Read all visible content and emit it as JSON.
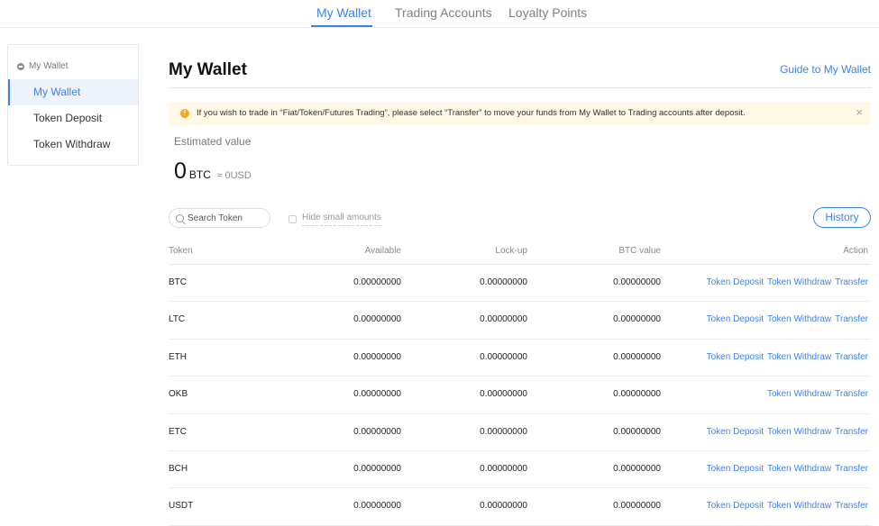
{
  "topnav": {
    "tabs": [
      {
        "label": "My Wallet",
        "active": true
      },
      {
        "label": "Trading Accounts",
        "active": false
      },
      {
        "label": "Loyalty Points",
        "active": false
      }
    ]
  },
  "sidebar": {
    "group_label": "My Wallet",
    "items": [
      {
        "label": "My Wallet",
        "active": true
      },
      {
        "label": "Token Deposit",
        "active": false
      },
      {
        "label": "Token Withdraw",
        "active": false
      }
    ]
  },
  "main": {
    "title": "My Wallet",
    "guide_link": "Guide to My Wallet",
    "notice": "If you wish to trade in “Fiat/Token/Futures Trading”, please select “Transfer” to move your funds from My Wallet to Trading accounts after deposit.",
    "notice_close": "×",
    "estimated_label": "Estimated value",
    "estimated_value": "0",
    "estimated_unit": "BTC",
    "estimated_usd": "≈ 0USD",
    "search_placeholder": "Search Token",
    "hide_small_label": "Hide small amounts",
    "history_button": "History"
  },
  "table": {
    "headers": {
      "token": "Token",
      "available": "Available",
      "lockup": "Lock-up",
      "btc_value": "BTC value",
      "action": "Action"
    },
    "action_labels": {
      "deposit": "Token Deposit",
      "withdraw": "Token Withdraw",
      "transfer": "Transfer"
    },
    "rows": [
      {
        "token": "BTC",
        "available": "0.00000000",
        "lockup": "0.00000000",
        "btc_value": "0.00000000",
        "deposit": true
      },
      {
        "token": "LTC",
        "available": "0.00000000",
        "lockup": "0.00000000",
        "btc_value": "0.00000000",
        "deposit": true
      },
      {
        "token": "ETH",
        "available": "0.00000000",
        "lockup": "0.00000000",
        "btc_value": "0.00000000",
        "deposit": true
      },
      {
        "token": "OKB",
        "available": "0.00000000",
        "lockup": "0.00000000",
        "btc_value": "0.00000000",
        "deposit": false
      },
      {
        "token": "ETC",
        "available": "0.00000000",
        "lockup": "0.00000000",
        "btc_value": "0.00000000",
        "deposit": true
      },
      {
        "token": "BCH",
        "available": "0.00000000",
        "lockup": "0.00000000",
        "btc_value": "0.00000000",
        "deposit": true
      },
      {
        "token": "USDT",
        "available": "0.00000000",
        "lockup": "0.00000000",
        "btc_value": "0.00000000",
        "deposit": true
      }
    ]
  },
  "colors": {
    "accent": "#3b82f0",
    "notice_bg": "#fff8e6",
    "warning": "#f5a623"
  }
}
